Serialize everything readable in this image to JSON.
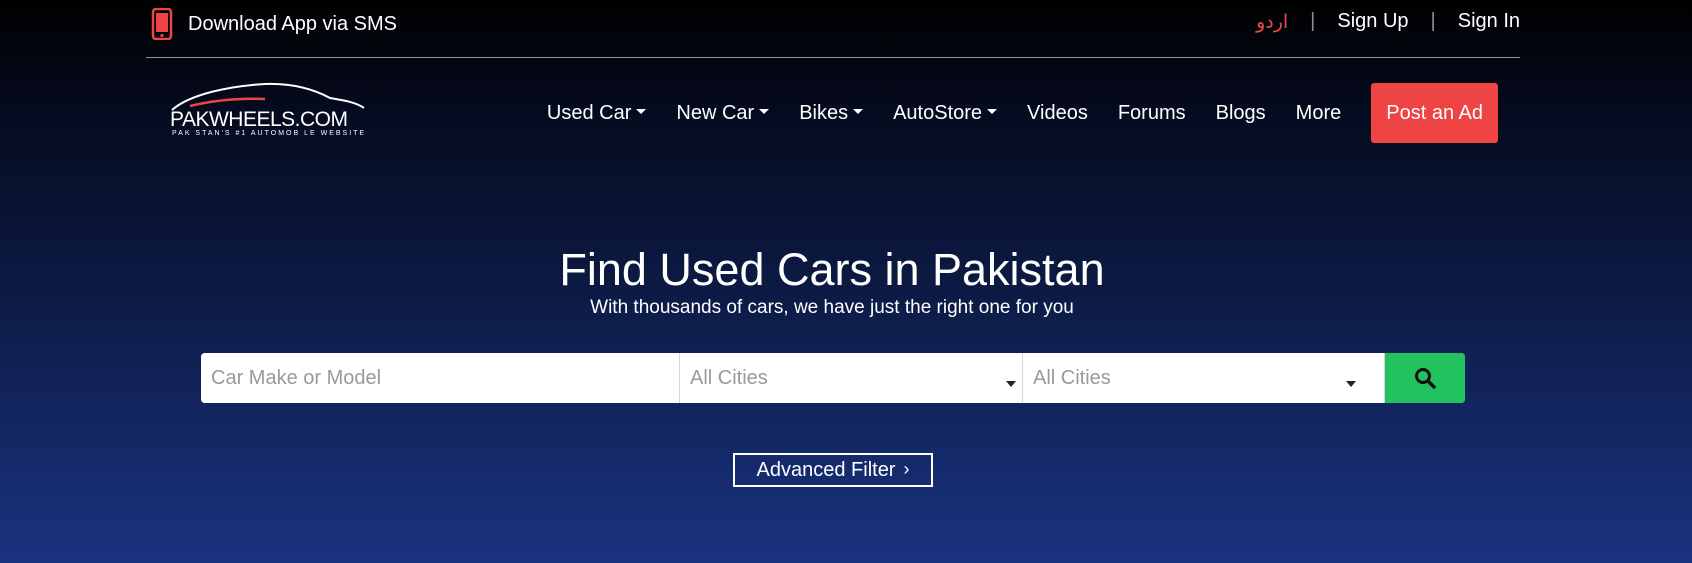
{
  "topbar": {
    "app_link_label": "Download App via SMS",
    "phone_icon": "mobile-phone-icon",
    "urdu_label": "اردو",
    "separator": "|",
    "sign_up_label": "Sign Up",
    "sign_in_label": "Sign In"
  },
  "logo": {
    "name": "PAKWHEELS.COM",
    "tagline": "PAK STAN'S #1 AUTOMOB LE WEBSITE"
  },
  "nav": {
    "items": [
      {
        "label": "Used Car",
        "has_dropdown": true
      },
      {
        "label": "New Car",
        "has_dropdown": true
      },
      {
        "label": "Bikes",
        "has_dropdown": true
      },
      {
        "label": "AutoStore",
        "has_dropdown": true
      },
      {
        "label": "Videos",
        "has_dropdown": false
      },
      {
        "label": "Forums",
        "has_dropdown": false
      },
      {
        "label": "Blogs",
        "has_dropdown": false
      },
      {
        "label": "More",
        "has_dropdown": false
      }
    ],
    "post_ad_label": "Post an Ad"
  },
  "hero": {
    "title": "Find Used Cars in Pakistan",
    "subtitle": "With thousands of cars, we have just the right one for you"
  },
  "search": {
    "make_model_placeholder": "Car Make or Model",
    "city_select_1_value": "All Cities",
    "city_select_2_value": "All Cities",
    "search_icon": "search-icon"
  },
  "advanced_filter": {
    "label": "Advanced Filter",
    "chevron": "›"
  },
  "colors": {
    "accent_red": "#ee4444",
    "search_green": "#22c35e",
    "urdu_red": "#e84a4a"
  }
}
